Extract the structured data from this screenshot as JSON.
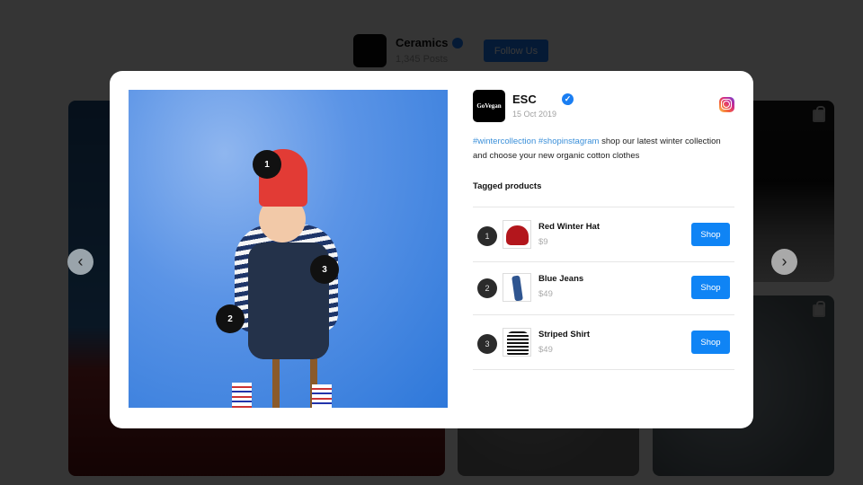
{
  "background": {
    "brand": {
      "name": "Ceramics",
      "posts": "1,345 Posts",
      "follow_label": "Follow Us"
    }
  },
  "navigation": {
    "prev_icon": "‹",
    "next_icon": "›"
  },
  "post": {
    "author": {
      "logo_text": "GoVegan",
      "name": "ESC",
      "date": "15 Oct 2019",
      "verified": true
    },
    "platform": "instagram",
    "caption": {
      "hashtags": [
        "#wintercollection",
        "#shopinstagram"
      ],
      "text": " shop our latest winter collection and choose your new  organic cotton clothes"
    },
    "tags": [
      {
        "number": "1"
      },
      {
        "number": "2"
      },
      {
        "number": "3"
      }
    ],
    "tagged_title": "Tagged products",
    "products": [
      {
        "number": "1",
        "name": "Red Winter Hat",
        "price": "$9",
        "shop_label": "Shop"
      },
      {
        "number": "2",
        "name": "Blue Jeans",
        "price": "$49",
        "shop_label": "Shop"
      },
      {
        "number": "3",
        "name": "Striped Shirt",
        "price": "$49",
        "shop_label": "Shop"
      }
    ]
  },
  "colors": {
    "accent": "#0f84f5",
    "hashtag": "#3a8fd9",
    "verified": "#1a7ef2"
  }
}
